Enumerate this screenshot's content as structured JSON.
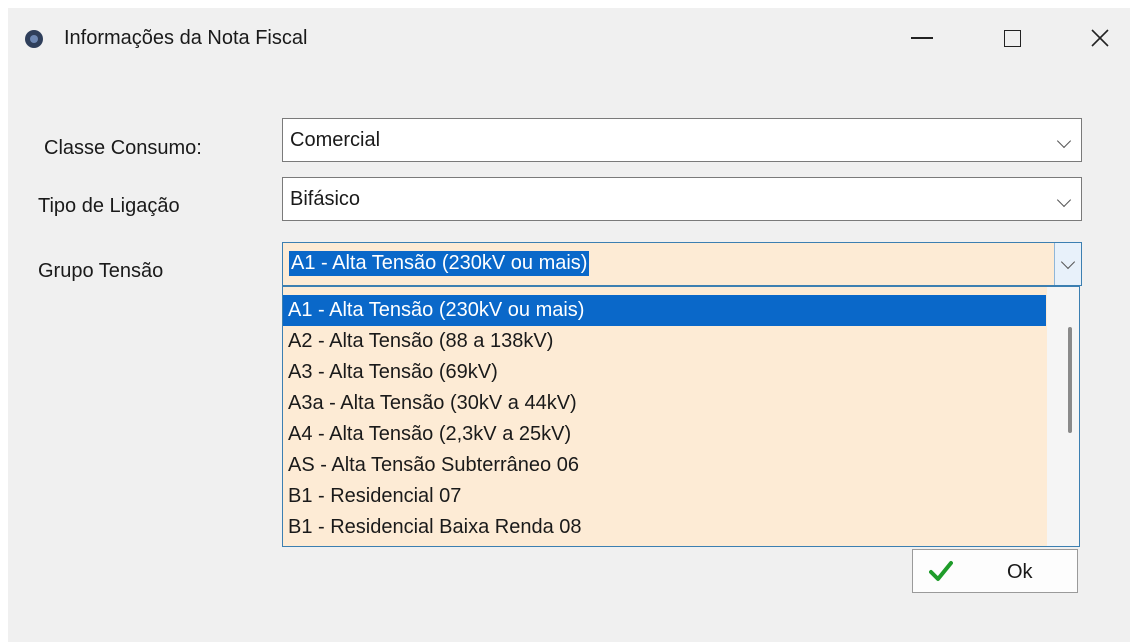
{
  "window": {
    "title": "Informações da Nota Fiscal"
  },
  "form": {
    "classe_consumo": {
      "label": "Classe Consumo:",
      "value": "Comercial"
    },
    "tipo_ligacao": {
      "label": "Tipo de Ligação",
      "value": "Bifásico"
    },
    "grupo_tensao": {
      "label": "Grupo Tensão",
      "value": "A1 - Alta Tensão (230kV ou mais)"
    }
  },
  "dropdown": {
    "items": [
      {
        "label": "A1 - Alta Tensão (230kV ou mais)",
        "selected": true
      },
      {
        "label": "A2 - Alta Tensão (88 a 138kV)",
        "selected": false
      },
      {
        "label": "A3 - Alta Tensão (69kV)",
        "selected": false
      },
      {
        "label": "A3a - Alta Tensão (30kV a 44kV)",
        "selected": false
      },
      {
        "label": "A4 - Alta Tensão (2,3kV a 25kV)",
        "selected": false
      },
      {
        "label": "AS - Alta Tensão Subterrâneo 06",
        "selected": false
      },
      {
        "label": "B1 - Residencial 07",
        "selected": false
      },
      {
        "label": "B1 - Residencial Baixa Renda 08",
        "selected": false
      }
    ]
  },
  "buttons": {
    "ok_label": "Ok"
  },
  "colors": {
    "selection": "#0a68c9",
    "dropdown_bg": "#fdebd5",
    "check_icon": "#1f9c2a"
  }
}
